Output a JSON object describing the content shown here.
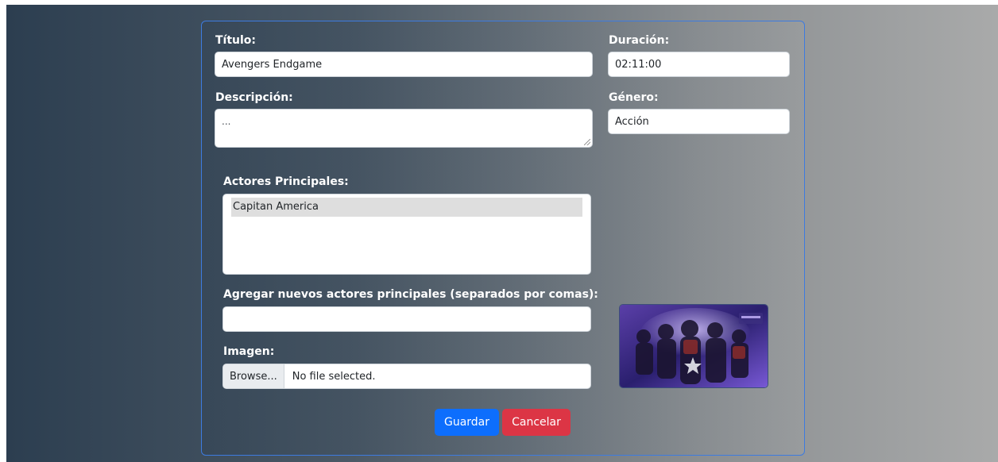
{
  "form": {
    "titulo_label": "Título:",
    "titulo_value": "Avengers Endgame",
    "duracion_label": "Duración:",
    "duracion_value": "02:11:00",
    "descripcion_label": "Descripción:",
    "descripcion_value": "...",
    "genero_label": "Género:",
    "genero_value": "Acción",
    "actores_label": "Actores Principales:",
    "actores_options": [
      {
        "label": "Capitan America",
        "selected": true
      }
    ],
    "nuevos_actores_label": "Agregar nuevos actores principales (separados por comas):",
    "nuevos_actores_value": "",
    "imagen_label": "Imagen:",
    "browse_label": "Browse...",
    "file_status": "No file selected.",
    "poster_icon": "movie-poster-image",
    "guardar_label": "Guardar",
    "cancelar_label": "Cancelar"
  },
  "colors": {
    "primary": "#0d6efd",
    "danger": "#dc3545",
    "card_border": "#3d7be0"
  }
}
